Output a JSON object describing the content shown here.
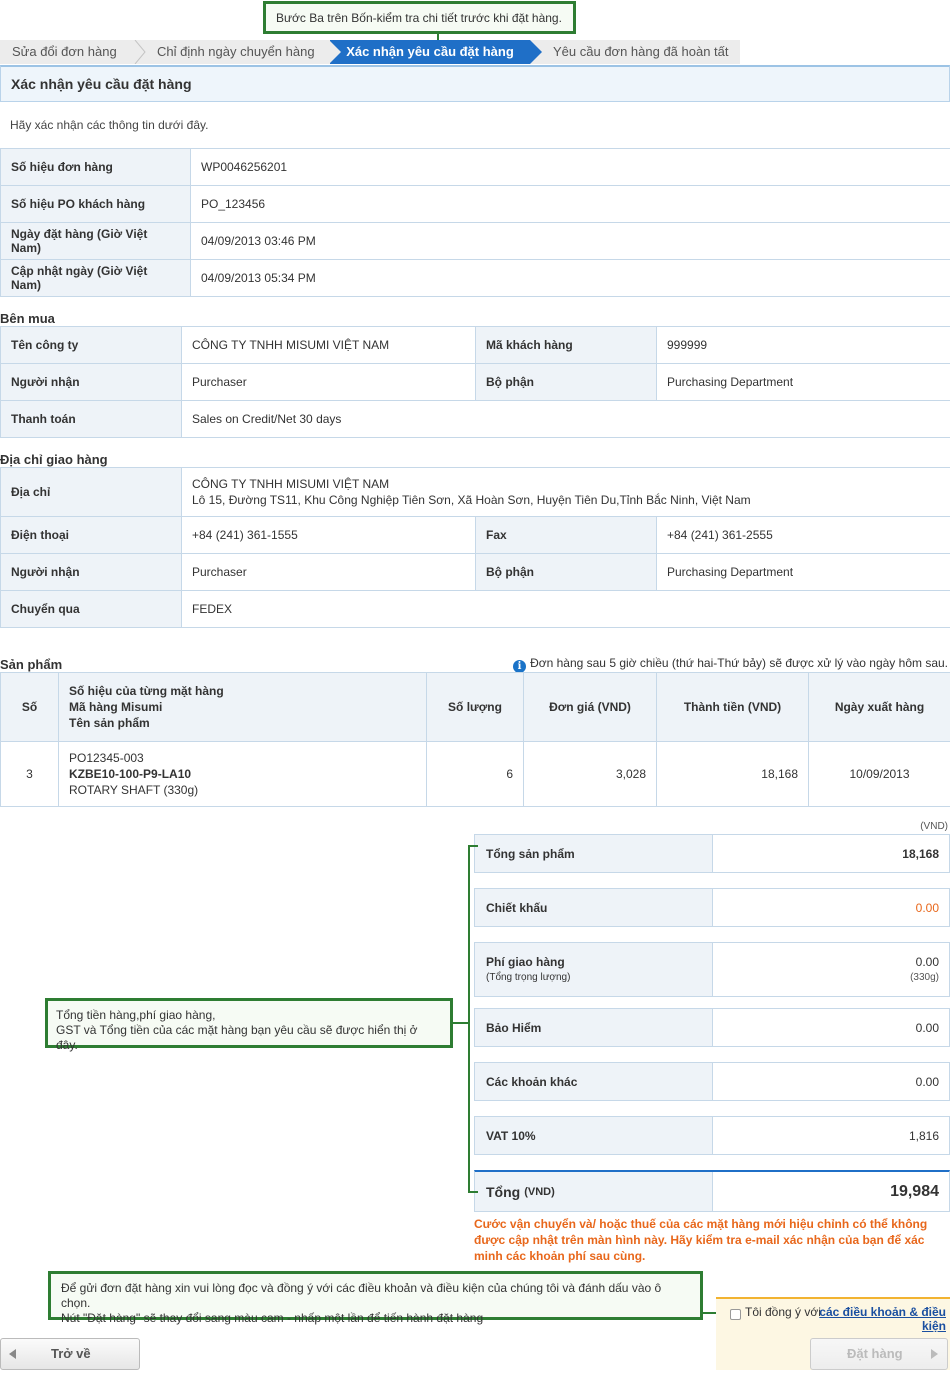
{
  "callouts": {
    "step_note": "Bước Ba trên Bốn-kiểm tra chi tiết trước khi đặt hàng.",
    "totals_note_1": "Tổng tiền hàng,phí giao hàng,",
    "totals_note_2": "GST và Tổng tiền của các mặt hàng bạn yêu cầu sẽ được hiển thị ở đây.",
    "order_note_1": "Để gửi đơn đặt hàng xin vui lòng đọc và đồng ý với các điều khoản và điều kiện của chúng tôi và đánh dấu vào ô chọn.",
    "order_note_2": "Nút \"Đặt hàng\" sẽ thay đổi sang màu cam - nhấp một lần để tiến hành đặt hàng"
  },
  "steps": [
    {
      "label": "Sửa đổi đơn hàng"
    },
    {
      "label": "Chỉ định ngày chuyển hàng"
    },
    {
      "label": "Xác nhận yêu cầu đặt hàng"
    },
    {
      "label": "Yêu cầu đơn hàng đã hoàn tất"
    }
  ],
  "page_title": "Xác nhận yêu cầu đặt hàng",
  "intro": "Hãy xác nhận các thông tin dưới đây.",
  "order_info": [
    {
      "label": "Số hiệu đơn hàng",
      "value": "WP0046256201"
    },
    {
      "label": "Số hiệu PO khách hàng",
      "value": "PO_123456"
    },
    {
      "label": "Ngày đặt hàng (Giờ Việt Nam)",
      "value": "04/09/2013 03:46 PM"
    },
    {
      "label": "Cập nhật ngày (Giờ Việt Nam)",
      "value": "04/09/2013 05:34 PM"
    }
  ],
  "buyer": {
    "heading": "Bên mua",
    "company_label": "Tên công ty",
    "company": "CÔNG TY TNHH MISUMI VIỆT NAM",
    "customer_code_label": "Mã khách hàng",
    "customer_code": "999999",
    "recipient_label": "Người nhận",
    "recipient": "Purchaser",
    "department_label": "Bộ phận",
    "department": "Purchasing Department",
    "payment_label": "Thanh toán",
    "payment": "Sales on Credit/Net 30 days"
  },
  "shipping": {
    "heading": "Địa chỉ giao hàng",
    "address_label": "Địa chỉ",
    "address_line1": "CÔNG TY TNHH MISUMI VIỆT NAM",
    "address_line2": "Lô 15, Đường TS11, Khu Công Nghiệp Tiên Sơn, Xã Hoàn Sơn, Huyện Tiên Du,Tỉnh Bắc Ninh, Việt Nam",
    "phone_label": "Điện thoại",
    "phone": "+84 (241) 361-1555",
    "fax_label": "Fax",
    "fax": "+84 (241) 361-2555",
    "recipient_label": "Người nhận",
    "recipient": "Purchaser",
    "department_label": "Bộ phận",
    "department": "Purchasing Department",
    "carrier_label": "Chuyển qua",
    "carrier": "FEDEX"
  },
  "products": {
    "heading": "Sản phẩm",
    "notice": "Đơn hàng sau 5 giờ chiều (thứ hai-Thứ bảy) sẽ được xử lý vào ngày hôm sau.",
    "columns": {
      "no": "Số",
      "item_1": "Số hiệu của từng mặt hàng",
      "item_2": "Mã hàng Misumi",
      "item_3": "Tên sản phẩm",
      "qty": "Số lượng",
      "unit_price": "Đơn giá (VND)",
      "amount": "Thành tiền (VND)",
      "ship_date": "Ngày xuất hàng"
    },
    "rows": [
      {
        "no": "3",
        "item_no": "PO12345-003",
        "part_no": "KZBE10-100-P9-LA10",
        "name": "ROTARY SHAFT (330g)",
        "qty": "6",
        "unit_price": "3,028",
        "amount": "18,168",
        "ship_date": "10/09/2013"
      }
    ]
  },
  "summary": {
    "unit": "(VND)",
    "subtotal_label": "Tổng sản phẩm",
    "subtotal": "18,168",
    "discount_label": "Chiết khấu",
    "discount": "0.00",
    "shipping_label": "Phí giao hàng",
    "shipping_sub": "(Tổng trọng lượng)",
    "shipping": "0.00",
    "weight": "(330g)",
    "insurance_label": "Bảo Hiểm",
    "insurance": "0.00",
    "other_label": "Các khoản khác",
    "other": "0.00",
    "vat_label": "VAT 10%",
    "vat": "1,816",
    "total_label": "Tổng",
    "total_unit": "(VND)",
    "total": "19,984",
    "discount_color": "#e8671b",
    "warning": "Cước vận chuyển và/ hoặc thuế của các mặt hàng mới hiệu chỉnh có thể không được cập nhật trên màn hình này. Hãy kiểm tra e-mail xác nhận của bạn để xác minh các khoản phí sau cùng."
  },
  "agreement": {
    "text": "Tôi đồng ý với",
    "link": "các điều khoản & điều kiện"
  },
  "buttons": {
    "back": "Trở về",
    "order": "Đặt hàng"
  },
  "colors": {
    "accent": "#1f6fc7",
    "callout_border": "#2e7d32",
    "warning": "#e8671b",
    "link": "#1a4fa0"
  }
}
